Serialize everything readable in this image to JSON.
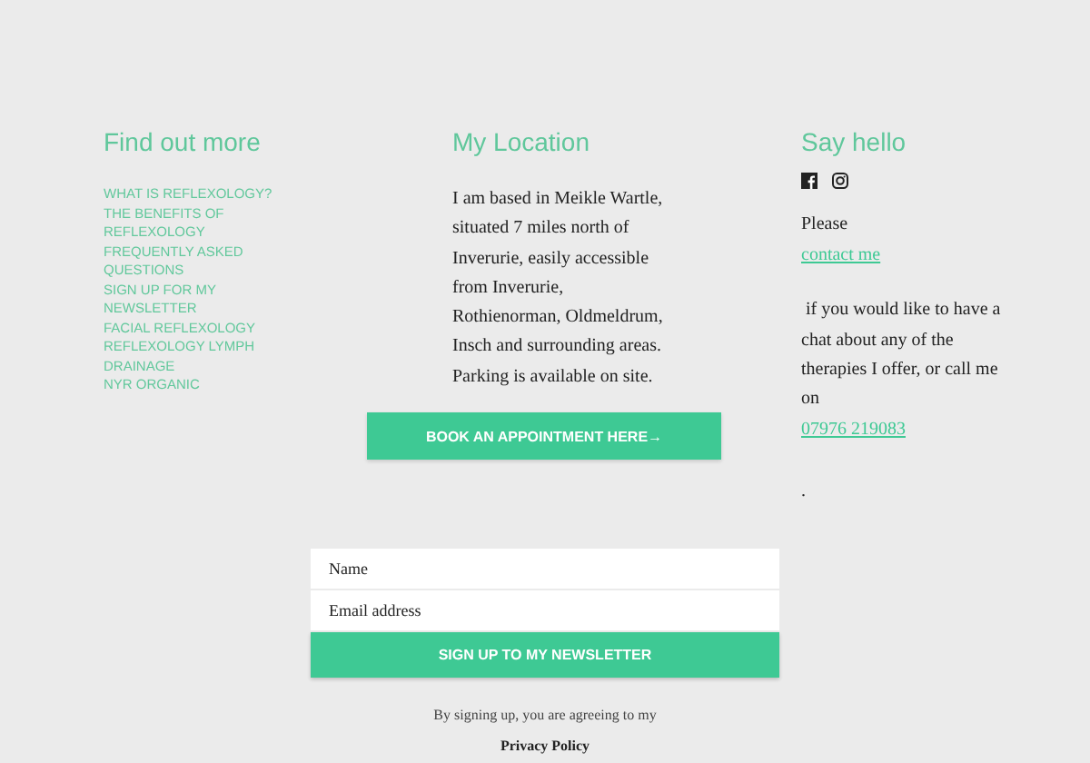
{
  "find_out_more": {
    "title": "Find out more",
    "links": [
      "WHAT IS REFLEXOLOGY?",
      "THE BENEFITS OF REFLEXOLOGY",
      "FREQUENTLY ASKED QUESTIONS",
      "SIGN UP FOR MY NEWSLETTER",
      "FACIAL REFLEXOLOGY",
      "REFLEXOLOGY LYMPH DRAINAGE",
      "NYR ORGANIC"
    ]
  },
  "location": {
    "title": "My Location",
    "lines": [
      "I am based in Meikle Wartle,",
      "situated 7 miles north of",
      "Inverurie, easily accessible",
      "from Inverurie,",
      "Rothienorman, Oldmeldrum,",
      "Insch and surrounding areas.",
      "Parking is available on site."
    ],
    "button": "BOOK AN APPOINTMENT HERE→"
  },
  "say_hello": {
    "title": "Say hello",
    "socials": [
      {
        "kind": "facebook"
      },
      {
        "kind": "instagram"
      }
    ],
    "please": "Please",
    "contact_link": "contact me",
    "message_lines": [
      " if you would like to have a",
      "chat about any of the",
      "therapies I offer, or call me",
      "on"
    ],
    "phone": "07976 219083",
    "dot": "."
  },
  "newsletter": {
    "name_placeholder": "Name",
    "email_placeholder": "Email address",
    "button": "SIGN UP TO MY NEWSLETTER",
    "note": "By signing up, you are agreeing to my",
    "privacy": "Privacy Policy"
  }
}
